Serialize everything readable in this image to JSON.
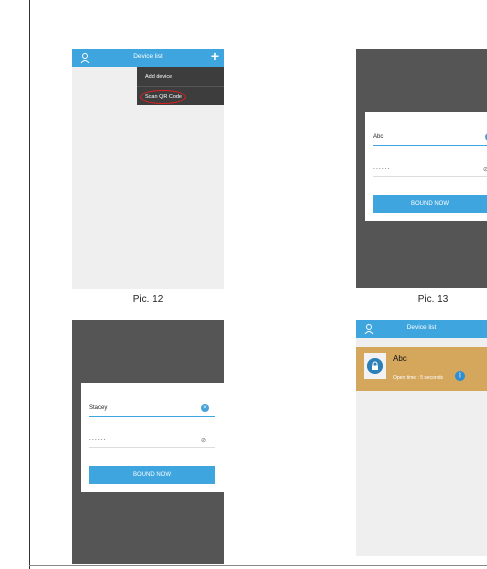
{
  "pic12": {
    "title": "Device list",
    "plus": "+",
    "menu": [
      "Add device",
      "Scan QR Code"
    ]
  },
  "pic13": {
    "username": "Abc",
    "password": "......",
    "button": "BOUND NOW"
  },
  "pic14": {
    "username": "Stacey",
    "password": "......",
    "button": "BOUND NOW"
  },
  "pic15": {
    "title": "Device list",
    "device_name": "Abc",
    "open_time": "Open time : 5 seconds"
  },
  "captions": {
    "pic12": "Pic. 12",
    "pic13": "Pic. 13"
  },
  "colors": {
    "accent": "#3ea5de",
    "menu_bg": "#3d3d3d",
    "device_card": "#d4a75d",
    "highlight_ring": "#dd2222"
  }
}
